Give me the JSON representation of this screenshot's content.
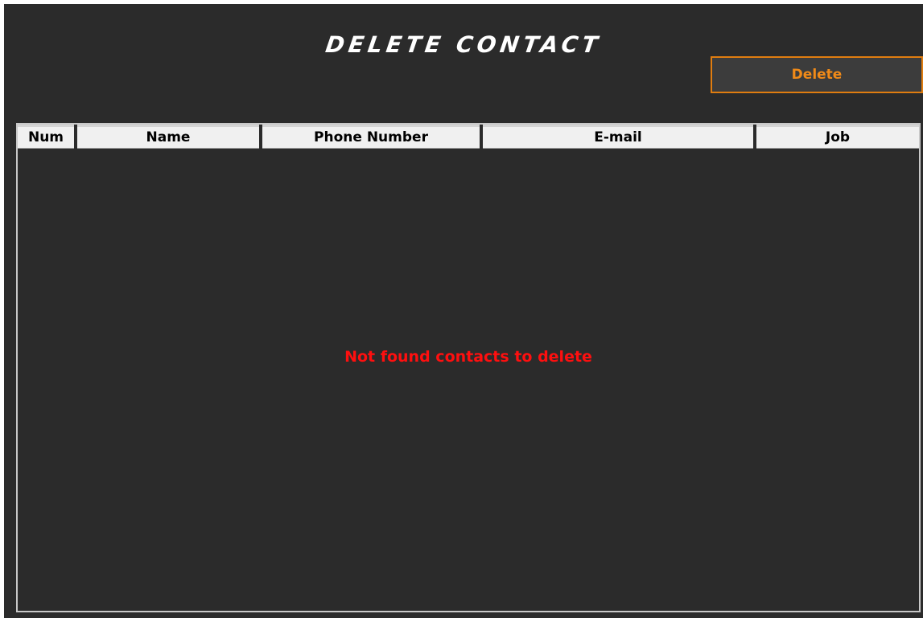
{
  "window": {
    "title": "DELETE CONTACT"
  },
  "toolbar": {
    "delete_label": "Delete"
  },
  "table": {
    "columns": [
      "Num",
      "Name",
      "Phone Number",
      "E-mail",
      "Job"
    ],
    "rows": [],
    "empty_message": "Not found contacts to delete"
  },
  "colors": {
    "background": "#2b2b2b",
    "accent": "#f08a18",
    "error": "#ff0f0f",
    "header_bg": "#f0f0f0"
  }
}
